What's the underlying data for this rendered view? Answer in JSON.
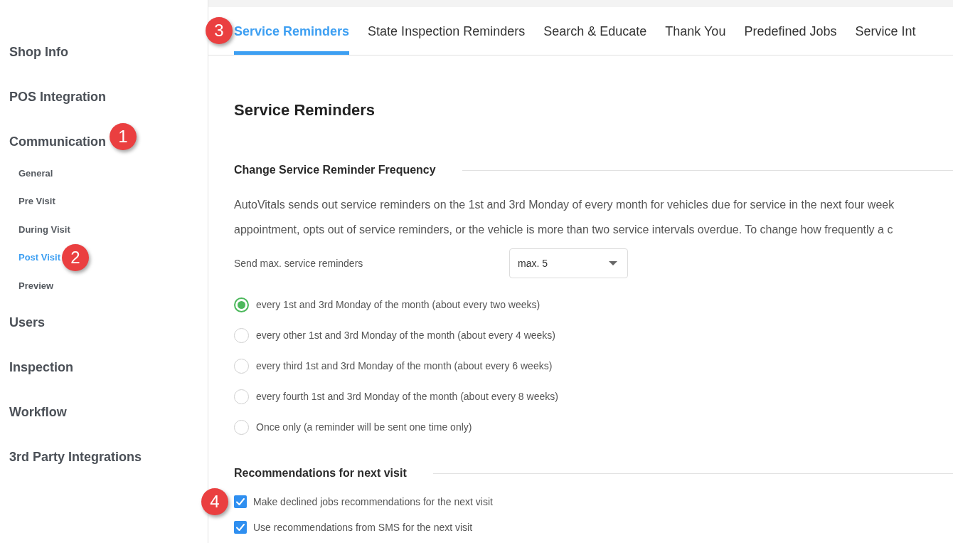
{
  "sidebar": {
    "items": [
      {
        "label": "Shop Info",
        "selected": false
      },
      {
        "label": "POS Integration",
        "selected": false
      },
      {
        "label": "Communication",
        "selected": false,
        "callout": "1",
        "children": [
          {
            "label": "General",
            "selected": false
          },
          {
            "label": "Pre Visit",
            "selected": false
          },
          {
            "label": "During Visit",
            "selected": false
          },
          {
            "label": "Post Visit",
            "selected": true,
            "callout": "2"
          },
          {
            "label": "Preview",
            "selected": false
          }
        ]
      },
      {
        "label": "Users",
        "selected": false
      },
      {
        "label": "Inspection",
        "selected": false
      },
      {
        "label": "Workflow",
        "selected": false
      },
      {
        "label": "3rd Party Integrations",
        "selected": false
      }
    ]
  },
  "tabs": [
    {
      "label": "Service Reminders",
      "selected": true,
      "callout": "3"
    },
    {
      "label": "State Inspection Reminders",
      "selected": false
    },
    {
      "label": "Search & Educate",
      "selected": false
    },
    {
      "label": "Thank You",
      "selected": false
    },
    {
      "label": "Predefined Jobs",
      "selected": false
    },
    {
      "label": "Service Int",
      "selected": false
    }
  ],
  "page": {
    "title": "Service Reminders",
    "sections": [
      {
        "heading": "Change Service Reminder Frequency",
        "description": [
          "AutoVitals sends out service reminders on the 1st and 3rd Monday of every month for vehicles due for service in the next four week",
          "appointment, opts out of service reminders, or the vehicle is more than two service intervals overdue. To change how frequently a c"
        ],
        "select": {
          "label": "Send max. service reminders",
          "value": "max. 5"
        },
        "options": [
          {
            "kind": "radio",
            "label": "every 1st and 3rd Monday of the month (about every two weeks)",
            "selected": true
          },
          {
            "kind": "radio",
            "label": "every other 1st and 3rd Monday of the month (about every 4 weeks)",
            "selected": false
          },
          {
            "kind": "radio",
            "label": "every third 1st and 3rd Monday of the month (about every 6 weeks)",
            "selected": false
          },
          {
            "kind": "radio",
            "label": "every fourth 1st and 3rd Monday of the month (about every 8 weeks)",
            "selected": false
          },
          {
            "kind": "radio",
            "label": "Once only (a reminder will be sent one time only)",
            "selected": false
          }
        ]
      },
      {
        "heading": "Recommendations for next visit",
        "options": [
          {
            "kind": "checkbox",
            "label": "Make declined jobs recommendations for the next visit",
            "checked": true,
            "callout": "4"
          },
          {
            "kind": "checkbox",
            "label": "Use recommendations from SMS for the next visit",
            "checked": true
          }
        ]
      }
    ]
  }
}
